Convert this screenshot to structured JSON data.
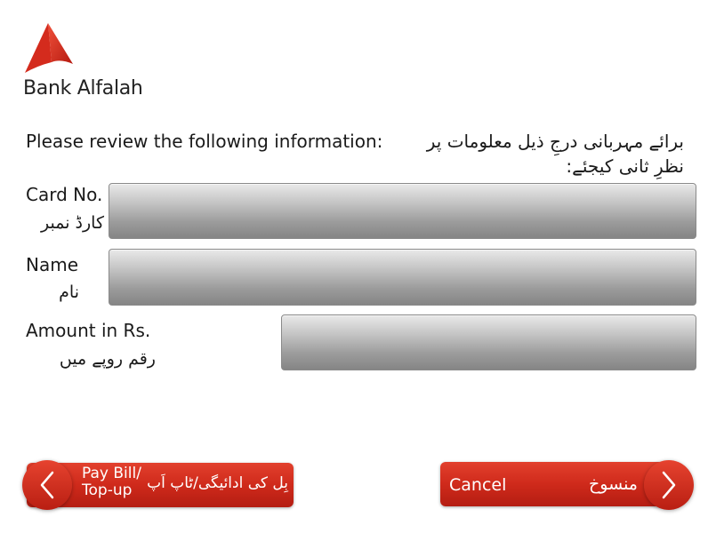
{
  "brand": {
    "name": "Bank Alfalah",
    "logo_icon": "alfalah-logo-icon"
  },
  "prompt": {
    "english": "Please review the following information:",
    "urdu": "برائے مہربانی درجِ ذیل معلومات پر نظرِ ثانی کیجئے:"
  },
  "fields": {
    "card": {
      "label_en": "Card No.",
      "label_ur": "کارڈ نمبر",
      "value": ""
    },
    "name": {
      "label_en": "Name",
      "label_ur": "نام",
      "value": ""
    },
    "amount": {
      "label_en": "Amount in Rs.",
      "label_ur": "رقم روپے میں",
      "value": ""
    }
  },
  "buttons": {
    "pay_bill": {
      "label_en_line1": "Pay Bill/",
      "label_en_line2": "Top-up",
      "label_ur": "بِل کی ادائیگی/ٹاپ اَپ",
      "icon": "chevron-left-icon"
    },
    "cancel": {
      "label_en": "Cancel",
      "label_ur": "منسوخ",
      "icon": "chevron-right-icon"
    }
  },
  "colors": {
    "accent": "#d32a1c",
    "field": "#a8a8a8"
  }
}
